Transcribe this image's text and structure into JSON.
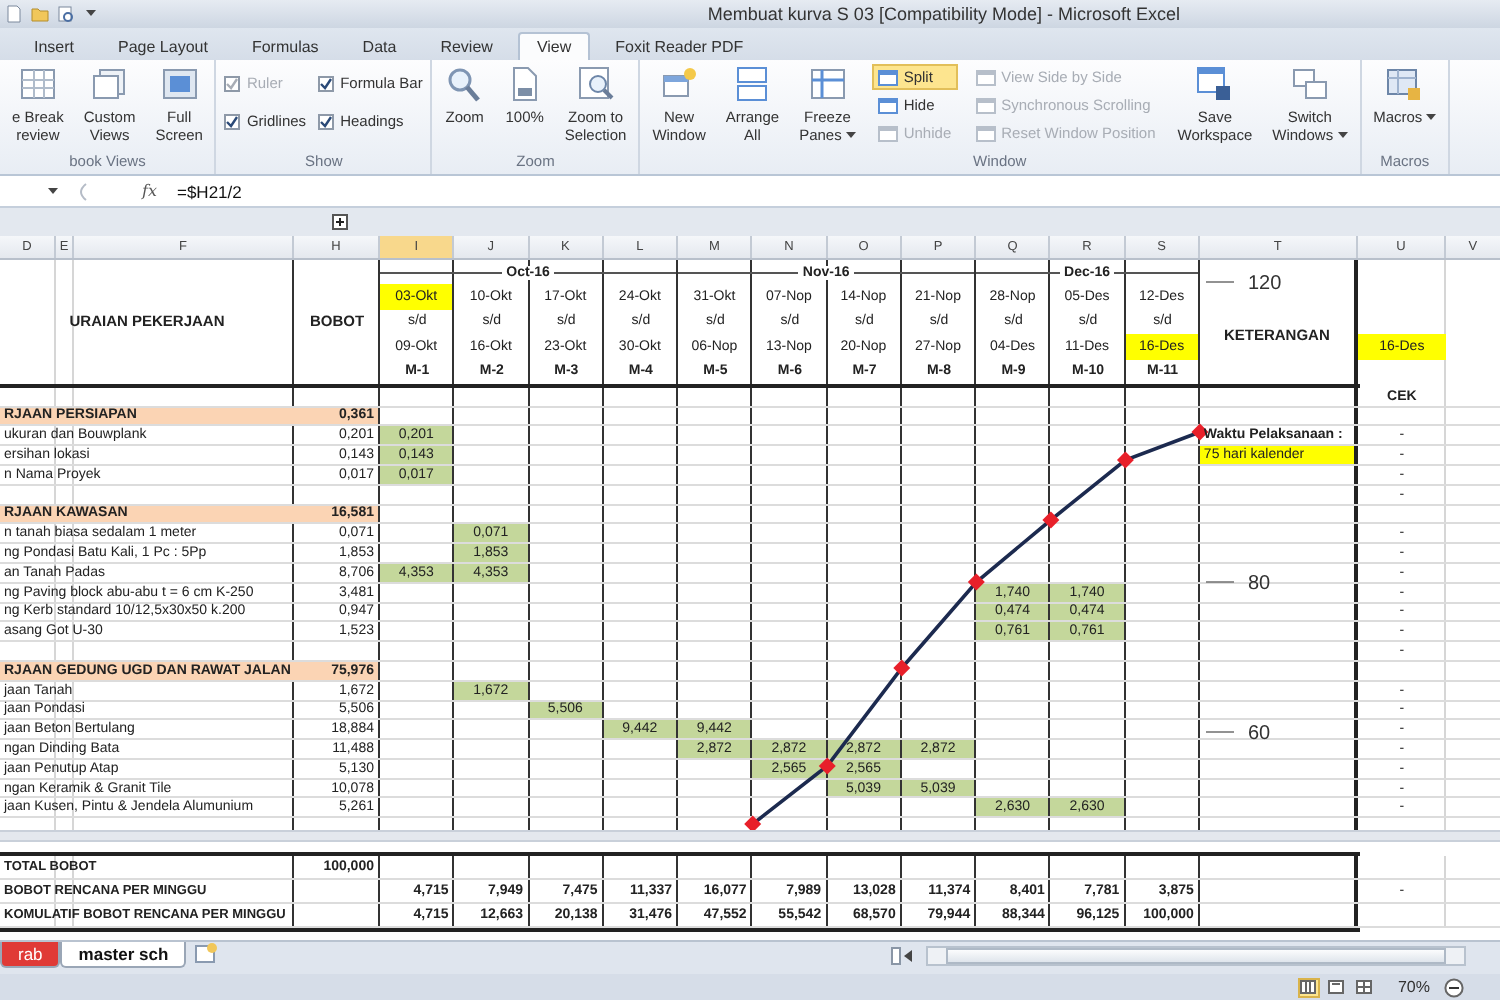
{
  "window": {
    "title": "Membuat kurva S 03  [Compatibility Mode] - Microsoft Excel"
  },
  "ribbon_tabs": [
    {
      "label": "Insert",
      "selected": false
    },
    {
      "label": "Page Layout",
      "selected": false
    },
    {
      "label": "Formulas",
      "selected": false
    },
    {
      "label": "Data",
      "selected": false
    },
    {
      "label": "Review",
      "selected": false
    },
    {
      "label": "View",
      "selected": true
    },
    {
      "label": "Foxit Reader PDF",
      "selected": false
    }
  ],
  "ribbon_groups": [
    {
      "label": "book Views",
      "items": [
        {
          "kind": "large",
          "label": "e Break\nreview",
          "menu": false
        },
        {
          "kind": "large",
          "label": "Custom\nViews",
          "menu": false
        },
        {
          "kind": "large",
          "label": "Full\nScreen",
          "menu": false
        }
      ]
    },
    {
      "label": "Show",
      "items": [
        {
          "kind": "check",
          "label": "Ruler",
          "checked": true,
          "disabled": true
        },
        {
          "kind": "check",
          "label": "Gridlines",
          "checked": true,
          "disabled": false
        },
        {
          "kind": "check",
          "label": "Formula Bar",
          "checked": true,
          "disabled": false
        },
        {
          "kind": "check",
          "label": "Headings",
          "checked": true,
          "disabled": false
        }
      ]
    },
    {
      "label": "Zoom",
      "items": [
        {
          "kind": "large",
          "label": "Zoom",
          "menu": false
        },
        {
          "kind": "large",
          "label": "100%",
          "menu": false
        },
        {
          "kind": "large",
          "label": "Zoom to\nSelection",
          "menu": false
        }
      ]
    },
    {
      "label": "Window",
      "items": [
        {
          "kind": "large",
          "label": "New\nWindow",
          "menu": false
        },
        {
          "kind": "large",
          "label": "Arrange\nAll",
          "menu": false
        },
        {
          "kind": "large",
          "label": "Freeze\nPanes",
          "menu": true
        },
        {
          "kind": "small",
          "label": "Split",
          "selected": true,
          "disabled": false
        },
        {
          "kind": "small",
          "label": "Hide",
          "selected": false,
          "disabled": false
        },
        {
          "kind": "small",
          "label": "Unhide",
          "selected": false,
          "disabled": true
        },
        {
          "kind": "small",
          "label": "View Side by Side",
          "selected": false,
          "disabled": true
        },
        {
          "kind": "small",
          "label": "Synchronous Scrolling",
          "selected": false,
          "disabled": true
        },
        {
          "kind": "small",
          "label": "Reset Window Position",
          "selected": false,
          "disabled": true
        },
        {
          "kind": "large",
          "label": "Save\nWorkspace",
          "menu": false
        },
        {
          "kind": "large",
          "label": "Switch\nWindows",
          "menu": true
        }
      ]
    },
    {
      "label": "Macros",
      "items": [
        {
          "kind": "large",
          "label": "Macros",
          "menu": true
        }
      ]
    }
  ],
  "formula_bar": {
    "function_label": "fx",
    "formula": "=$H21/2"
  },
  "columns": [
    {
      "label": "D",
      "selected": false
    },
    {
      "label": "E",
      "selected": false
    },
    {
      "label": "F",
      "selected": false
    },
    {
      "label": "H",
      "selected": false
    },
    {
      "label": "I",
      "selected": true
    },
    {
      "label": "J",
      "selected": false
    },
    {
      "label": "K",
      "selected": false
    },
    {
      "label": "L",
      "selected": false
    },
    {
      "label": "M",
      "selected": false
    },
    {
      "label": "N",
      "selected": false
    },
    {
      "label": "O",
      "selected": false
    },
    {
      "label": "P",
      "selected": false
    },
    {
      "label": "Q",
      "selected": false
    },
    {
      "label": "R",
      "selected": false
    },
    {
      "label": "S",
      "selected": false
    },
    {
      "label": "T",
      "selected": false
    },
    {
      "label": "U",
      "selected": false
    },
    {
      "label": "V",
      "selected": false
    }
  ],
  "header": {
    "title": "URAIAN PEKERJAAN",
    "weight": "BOBOT",
    "remarks": "KETERANGAN",
    "end_date": {
      "text": "16-Des",
      "highlighted": true
    },
    "check": "CEK",
    "months": [
      {
        "label": "Oct-16",
        "weeks": [
          {
            "from": "03-Okt",
            "sep": "s/d",
            "to": "09-Okt",
            "code": "M-1",
            "from_highlighted": true,
            "to_highlighted": false
          },
          {
            "from": "10-Okt",
            "sep": "s/d",
            "to": "16-Okt",
            "code": "M-2",
            "from_highlighted": false,
            "to_highlighted": false
          },
          {
            "from": "17-Okt",
            "sep": "s/d",
            "to": "23-Okt",
            "code": "M-3",
            "from_highlighted": false,
            "to_highlighted": false
          },
          {
            "from": "24-Okt",
            "sep": "s/d",
            "to": "30-Okt",
            "code": "M-4",
            "from_highlighted": false,
            "to_highlighted": false
          }
        ]
      },
      {
        "label": "Nov-16",
        "weeks": [
          {
            "from": "31-Okt",
            "sep": "s/d",
            "to": "06-Nop",
            "code": "M-5",
            "from_highlighted": false,
            "to_highlighted": false
          },
          {
            "from": "07-Nop",
            "sep": "s/d",
            "to": "13-Nop",
            "code": "M-6",
            "from_highlighted": false,
            "to_highlighted": false
          },
          {
            "from": "14-Nop",
            "sep": "s/d",
            "to": "20-Nop",
            "code": "M-7",
            "from_highlighted": false,
            "to_highlighted": false
          },
          {
            "from": "21-Nop",
            "sep": "s/d",
            "to": "27-Nop",
            "code": "M-8",
            "from_highlighted": false,
            "to_highlighted": false
          }
        ]
      },
      {
        "label": "Dec-16",
        "weeks": [
          {
            "from": "28-Nop",
            "sep": "s/d",
            "to": "04-Des",
            "code": "M-9",
            "from_highlighted": false,
            "to_highlighted": false
          },
          {
            "from": "05-Des",
            "sep": "s/d",
            "to": "11-Des",
            "code": "M-10",
            "from_highlighted": false,
            "to_highlighted": false
          },
          {
            "from": "12-Des",
            "sep": "s/d",
            "to": "16-Des",
            "code": "M-11",
            "from_highlighted": false,
            "to_highlighted": true
          }
        ]
      }
    ]
  },
  "rows": [
    {
      "kind": "section",
      "label": "RJAAN PERSIAPAN",
      "bobot": "0,361"
    },
    {
      "kind": "item",
      "label": "ukuran dan Bouwplank",
      "bobot": "0,201",
      "cells": [
        "0,201",
        null,
        null,
        null,
        null,
        null,
        null,
        null,
        null,
        null,
        null
      ],
      "check": "-",
      "note": {
        "text": "Waktu Pelaksanaan :",
        "highlighted": false
      }
    },
    {
      "kind": "item",
      "label": "ersihan lokasi",
      "bobot": "0,143",
      "cells": [
        "0,143",
        null,
        null,
        null,
        null,
        null,
        null,
        null,
        null,
        null,
        null
      ],
      "check": "-",
      "note": {
        "text": "75 hari kalender",
        "highlighted": true
      }
    },
    {
      "kind": "item",
      "label": "n Nama Proyek",
      "bobot": "0,017",
      "cells": [
        "0,017",
        null,
        null,
        null,
        null,
        null,
        null,
        null,
        null,
        null,
        null
      ],
      "check": "-"
    },
    {
      "kind": "blank",
      "check": "-"
    },
    {
      "kind": "section",
      "label": "RJAAN KAWASAN",
      "bobot": "16,581"
    },
    {
      "kind": "item",
      "label": "n tanah biasa sedalam 1 meter",
      "bobot": "0,071",
      "cells": [
        null,
        "0,071",
        null,
        null,
        null,
        null,
        null,
        null,
        null,
        null,
        null
      ],
      "check": "-"
    },
    {
      "kind": "item",
      "label": "ng Pondasi Batu Kali, 1 Pc : 5Pp",
      "bobot": "1,853",
      "cells": [
        null,
        "1,853",
        null,
        null,
        null,
        null,
        null,
        null,
        null,
        null,
        null
      ],
      "check": "-"
    },
    {
      "kind": "item",
      "label": "an Tanah Padas",
      "bobot": "8,706",
      "cells": [
        "4,353",
        "4,353",
        null,
        null,
        null,
        null,
        null,
        null,
        null,
        null,
        null
      ],
      "check": "-"
    },
    {
      "kind": "item",
      "label": "ng Paving block abu-abu t = 6 cm K-250",
      "bobot": "3,481",
      "cells": [
        null,
        null,
        null,
        null,
        null,
        null,
        null,
        null,
        "1,740",
        "1,740",
        null
      ],
      "check": "-"
    },
    {
      "kind": "item",
      "label": "ng Kerb standard 10/12,5x30x50 k.200",
      "bobot": "0,947",
      "cells": [
        null,
        null,
        null,
        null,
        null,
        null,
        null,
        null,
        "0,474",
        "0,474",
        null
      ],
      "check": "-"
    },
    {
      "kind": "item",
      "label": "asang Got U-30",
      "bobot": "1,523",
      "cells": [
        null,
        null,
        null,
        null,
        null,
        null,
        null,
        null,
        "0,761",
        "0,761",
        null
      ],
      "check": "-"
    },
    {
      "kind": "blank",
      "check": "-"
    },
    {
      "kind": "section",
      "label": "RJAAN GEDUNG UGD DAN RAWAT JALAN",
      "bobot": "75,976"
    },
    {
      "kind": "item",
      "label": "jaan Tanah",
      "bobot": "1,672",
      "cells": [
        null,
        "1,672",
        null,
        null,
        null,
        null,
        null,
        null,
        null,
        null,
        null
      ],
      "check": "-"
    },
    {
      "kind": "item",
      "label": "jaan Pondasi",
      "bobot": "5,506",
      "cells": [
        null,
        null,
        "5,506",
        null,
        null,
        null,
        null,
        null,
        null,
        null,
        null
      ],
      "check": "-"
    },
    {
      "kind": "item",
      "label": "jaan Beton Bertulang",
      "bobot": "18,884",
      "cells": [
        null,
        null,
        null,
        "9,442",
        "9,442",
        null,
        null,
        null,
        null,
        null,
        null
      ],
      "check": "-"
    },
    {
      "kind": "item",
      "label": "ngan Dinding Bata",
      "bobot": "11,488",
      "cells": [
        null,
        null,
        null,
        null,
        "2,872",
        "2,872",
        "2,872",
        "2,872",
        null,
        null,
        null
      ],
      "check": "-"
    },
    {
      "kind": "item",
      "label": "jaan Penutup Atap",
      "bobot": "5,130",
      "cells": [
        null,
        null,
        null,
        null,
        null,
        "2,565",
        "2,565",
        null,
        null,
        null,
        null
      ],
      "check": "-"
    },
    {
      "kind": "item",
      "label": "ngan Keramik & Granit Tile",
      "bobot": "10,078",
      "cells": [
        null,
        null,
        null,
        null,
        null,
        null,
        "5,039",
        "5,039",
        null,
        null,
        null
      ],
      "check": "-"
    },
    {
      "kind": "item",
      "label": "jaan Kusen, Pintu & Jendela Alumunium",
      "bobot": "5,261",
      "cells": [
        null,
        null,
        null,
        null,
        null,
        null,
        null,
        null,
        "2,630",
        "2,630",
        null
      ],
      "check": "-"
    }
  ],
  "s_curve": {
    "axis_labels": [
      "120",
      "80",
      "60"
    ]
  },
  "totals": [
    {
      "label": "TOTAL BOBOT",
      "bobot": "100,000"
    },
    {
      "label": "BOBOT RENCANA PER MINGGU",
      "cells": [
        "4,715",
        "7,949",
        "7,475",
        "11,337",
        "16,077",
        "7,989",
        "13,028",
        "11,374",
        "8,401",
        "7,781",
        "3,875"
      ],
      "check": "-"
    },
    {
      "label": "KOMULATIF BOBOT RENCANA PER MINGGU",
      "cells": [
        "4,715",
        "12,663",
        "20,138",
        "31,476",
        "47,552",
        "55,542",
        "68,570",
        "79,944",
        "88,344",
        "96,125",
        "100,000"
      ]
    }
  ],
  "sheet_tabs": [
    {
      "label": "rab",
      "selected": false,
      "color": "#e03a36"
    },
    {
      "label": "master sch",
      "selected": true
    }
  ],
  "status_bar": {
    "views": [
      {
        "selected": true
      },
      {
        "selected": false
      },
      {
        "selected": false
      }
    ],
    "zoom": "70%"
  }
}
